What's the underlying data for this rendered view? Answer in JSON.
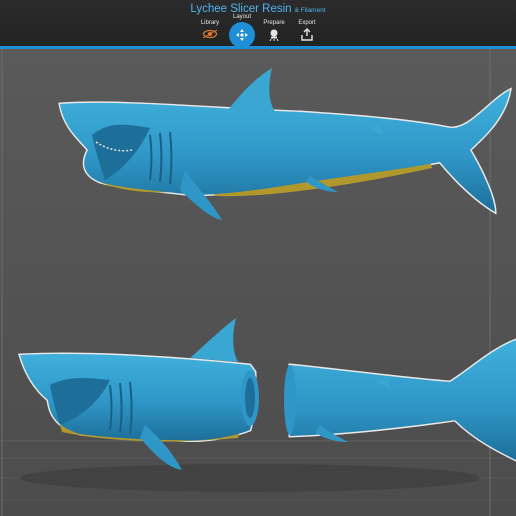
{
  "app": {
    "title": "Lychee Slicer Resin",
    "subtitle": "& Filament"
  },
  "tabs": [
    {
      "label": "Library",
      "icon": "library-icon",
      "active": false
    },
    {
      "label": "Layout",
      "icon": "layout-icon",
      "active": true
    },
    {
      "label": "Prepare",
      "icon": "prepare-icon",
      "active": false
    },
    {
      "label": "Export",
      "icon": "export-icon",
      "active": false
    }
  ],
  "scene": {
    "models": [
      "shark-full-model",
      "shark-head-part",
      "shark-tail-part"
    ],
    "colors": {
      "model": "#3aa6d2",
      "model_dark": "#1d6f9a",
      "support": "#b0982c",
      "bed": "#5a5a5a",
      "accent": "#1e8fd6"
    }
  }
}
